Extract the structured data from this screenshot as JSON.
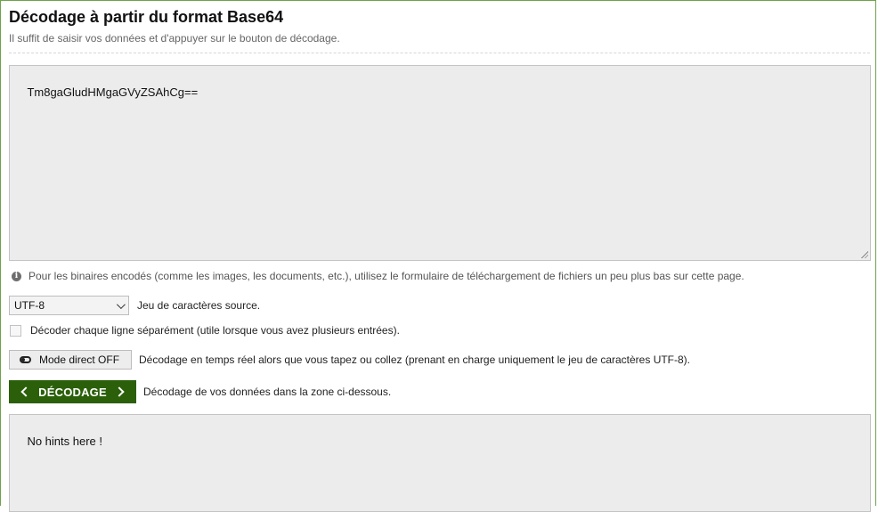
{
  "header": {
    "title": "Décodage à partir du format Base64",
    "subtitle": "Il suffit de saisir vos données et d'appuyer sur le bouton de décodage."
  },
  "input": {
    "value": "Tm8gaGludHMgaGVyZSAhCg=="
  },
  "info": {
    "text": "Pour les binaires encodés (comme les images, les documents, etc.), utilisez le formulaire de téléchargement de fichiers un peu plus bas sur cette page."
  },
  "charset": {
    "selected": "UTF-8",
    "label": "Jeu de caractères source."
  },
  "per_line": {
    "checked": false,
    "label": "Décoder chaque ligne séparément (utile lorsque vous avez plusieurs entrées)."
  },
  "live_mode": {
    "button_label": "Mode direct OFF",
    "description": "Décodage en temps réel alors que vous tapez ou collez (prenant en charge uniquement le jeu de caractères UTF-8)."
  },
  "decode": {
    "button_label": "DÉCODAGE",
    "description": "Décodage de vos données dans la zone ci-dessous."
  },
  "output": {
    "value": "No hints here !"
  },
  "colors": {
    "accent": "#2b5f0a",
    "frame_border": "#6fa24a"
  }
}
